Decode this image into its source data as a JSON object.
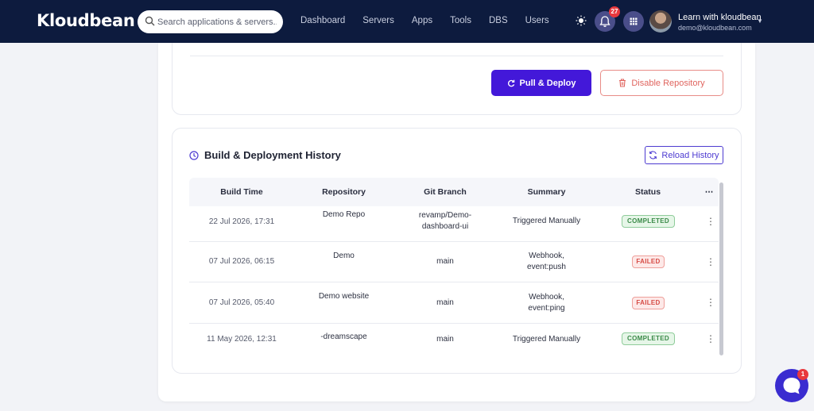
{
  "navbar": {
    "logo_text": "Kloudbean",
    "search_placeholder": "Search applications & servers...",
    "menu": [
      "Dashboard",
      "Servers",
      "Apps",
      "Tools",
      "DBS",
      "Users"
    ],
    "notification_count": "27",
    "user_name": "Learn with kloudbean",
    "user_email": "demo@kloudbean.com"
  },
  "repo_actions": {
    "pull_deploy_label": "Pull & Deploy",
    "disable_label": "Disable Repository"
  },
  "history": {
    "title": "Build & Deployment History",
    "reload_label": "Reload History",
    "columns": [
      "Build Time",
      "Repository",
      "Git Branch",
      "Summary",
      "Status",
      "⋯"
    ],
    "rows": [
      {
        "time": "22 Jul 2026, 17:31",
        "repo": "Demo Repo",
        "branch_l1": "revamp/Demo-",
        "branch_l2": "dashboard-ui",
        "summary_l1": "Triggered Manually",
        "summary_l2": "",
        "status": "COMPLETED"
      },
      {
        "time": "07 Jul 2026, 06:15",
        "repo": "Demo",
        "branch_l1": "main",
        "branch_l2": "",
        "summary_l1": "Webhook,",
        "summary_l2": "event:push",
        "status": "FAILED"
      },
      {
        "time": "07 Jul 2026, 05:40",
        "repo": "Demo website",
        "branch_l1": "main",
        "branch_l2": "",
        "summary_l1": "Webhook,",
        "summary_l2": "event:ping",
        "status": "FAILED"
      },
      {
        "time": "11 May 2026, 12:31",
        "repo": "-dreamscape",
        "branch_l1": "main",
        "branch_l2": "",
        "summary_l1": "Triggered Manually",
        "summary_l2": "",
        "status": "COMPLETED"
      }
    ]
  },
  "chat": {
    "badge": "1"
  },
  "colors": {
    "nav_bg": "#0d1b3e",
    "primary": "#4318d9",
    "danger": "#e0655f",
    "success": "#3a8a48"
  }
}
